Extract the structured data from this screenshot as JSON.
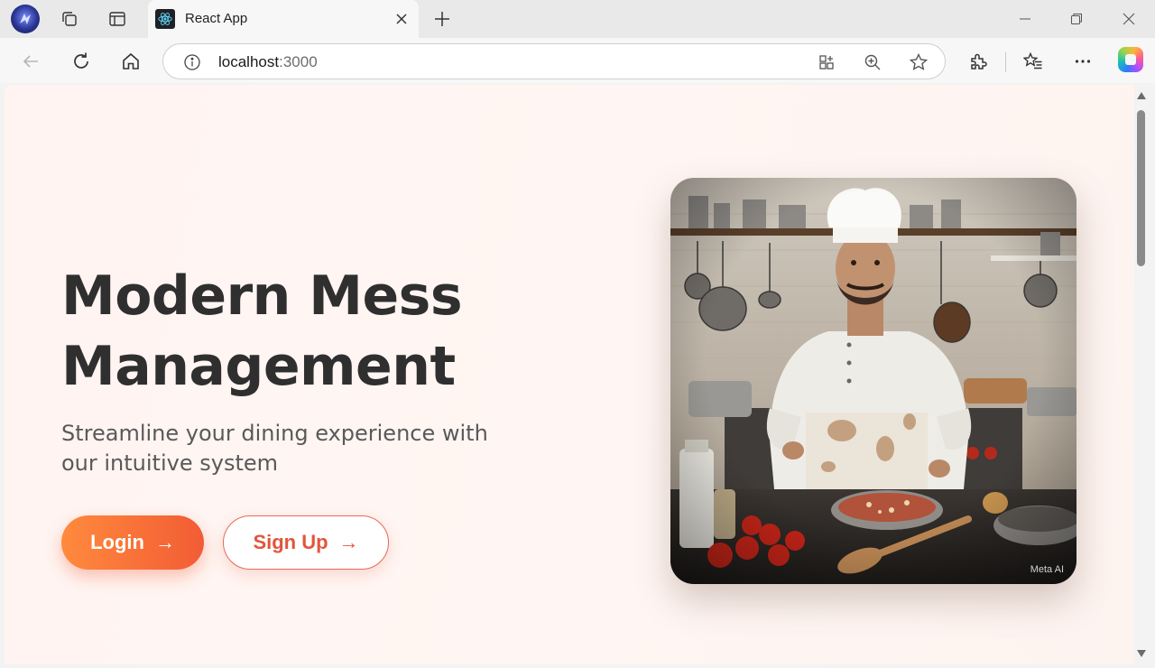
{
  "browser": {
    "tab": {
      "title": "React App"
    },
    "address": {
      "host": "localhost",
      "port": ":3000"
    }
  },
  "page": {
    "hero": {
      "title": "Modern Mess Management",
      "subtitle": "Streamline your dining experience with our intuitive system",
      "login_label": "Login",
      "signup_label": "Sign Up",
      "arrow": "→"
    },
    "image": {
      "watermark": "Meta AI"
    }
  },
  "colors": {
    "accent_start": "#ff8a3d",
    "accent_end": "#f25c35",
    "signup_text": "#e2553d",
    "title_text": "#2f2f2f",
    "page_bg": "#fff5f2"
  },
  "icons": [
    "profile-icon",
    "tab-actions-icon",
    "vertical-tabs-icon",
    "react-favicon-icon",
    "close-icon",
    "plus-icon",
    "minimize-icon",
    "restore-icon",
    "window-close-icon",
    "back-icon",
    "refresh-icon",
    "home-icon",
    "info-icon",
    "app-available-icon",
    "zoom-icon",
    "favorite-star-icon",
    "extensions-icon",
    "favorites-icon",
    "more-icon",
    "copilot-icon"
  ]
}
